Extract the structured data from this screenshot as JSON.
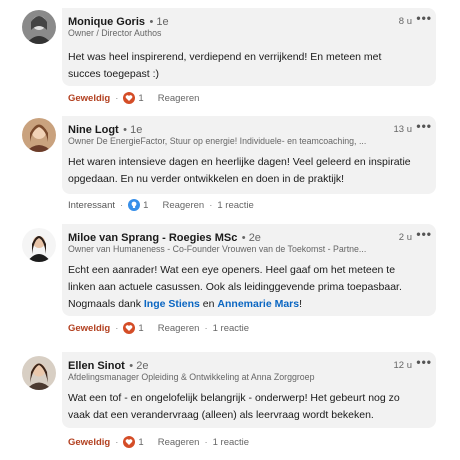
{
  "comments": [
    {
      "name": "Monique Goris",
      "degree": "• 1e",
      "headline": "Owner / Director Authos",
      "time": "8 u",
      "more": "•••",
      "body_lines": [
        "Het was heel inspirerend, verdiepend en verrijkend! En meteen met",
        "succes toegepast :)"
      ],
      "reaction_label": "Geweldig",
      "reaction_icon": "heart-icon",
      "reaction_count": "1",
      "reply_label": "Reageren",
      "reply_count": ""
    },
    {
      "name": "Nine Logt",
      "degree": "• 1e",
      "headline": "Owner De EnergieFactor, Stuur op energie! Individuele- en teamcoaching, ...",
      "time": "13 u",
      "more": "•••",
      "body_lines": [
        "Het waren intensieve dagen en heerlijke dagen! Veel geleerd en inspiratie",
        "opgedaan. En nu verder ontwikkelen en doen in de praktijk!"
      ],
      "reaction_label": "Interessant",
      "reaction_icon": "lightbulb-icon",
      "reaction_count": "1",
      "reply_label": "Reageren",
      "reply_count": "1 reactie"
    },
    {
      "name": "Miloe van Sprang - Roegies MSc",
      "degree": "• 2e",
      "headline": "Owner van Humaneness - Co-Founder Vrouwen van de Toekomst - Partne...",
      "time": "2 u",
      "more": "•••",
      "body_lines": [
        "Echt een aanrader! Wat een eye openers. Heel gaaf om het meteen te",
        "linken aan actuele casussen. Ook als leidinggevende prima toepasbaar."
      ],
      "body_last_prefix": "Nogmaals dank ",
      "mention_1": "Inge Stiens",
      "mention_join": " en ",
      "mention_2": "Annemarie Mars",
      "body_last_suffix": "!",
      "reaction_label": "Geweldig",
      "reaction_icon": "heart-icon",
      "reaction_count": "1",
      "reply_label": "Reageren",
      "reply_count": "1 reactie"
    },
    {
      "name": "Ellen Sinot",
      "degree": "• 2e",
      "headline": "Afdelingsmanager Opleiding & Ontwikkeling at Anna Zorggroep",
      "time": "12 u",
      "more": "•••",
      "body_lines": [
        "Wat een tof - en ongelofelijk belangrijk - onderwerp! Het gebeurt nog zo",
        "vaak dat een verandervraag (alleen) als leervraag wordt bekeken."
      ],
      "reaction_label": "Geweldig",
      "reaction_icon": "heart-icon",
      "reaction_count": "1",
      "reply_label": "Reageren",
      "reply_count": "1 reactie"
    }
  ],
  "separator": "·",
  "colors": {
    "bubble": "#f2f2f2",
    "reaction_red": "#b24020",
    "mention_blue": "#0a66c2",
    "heart_red": "#d44d27",
    "like_blue": "#378fe9"
  }
}
